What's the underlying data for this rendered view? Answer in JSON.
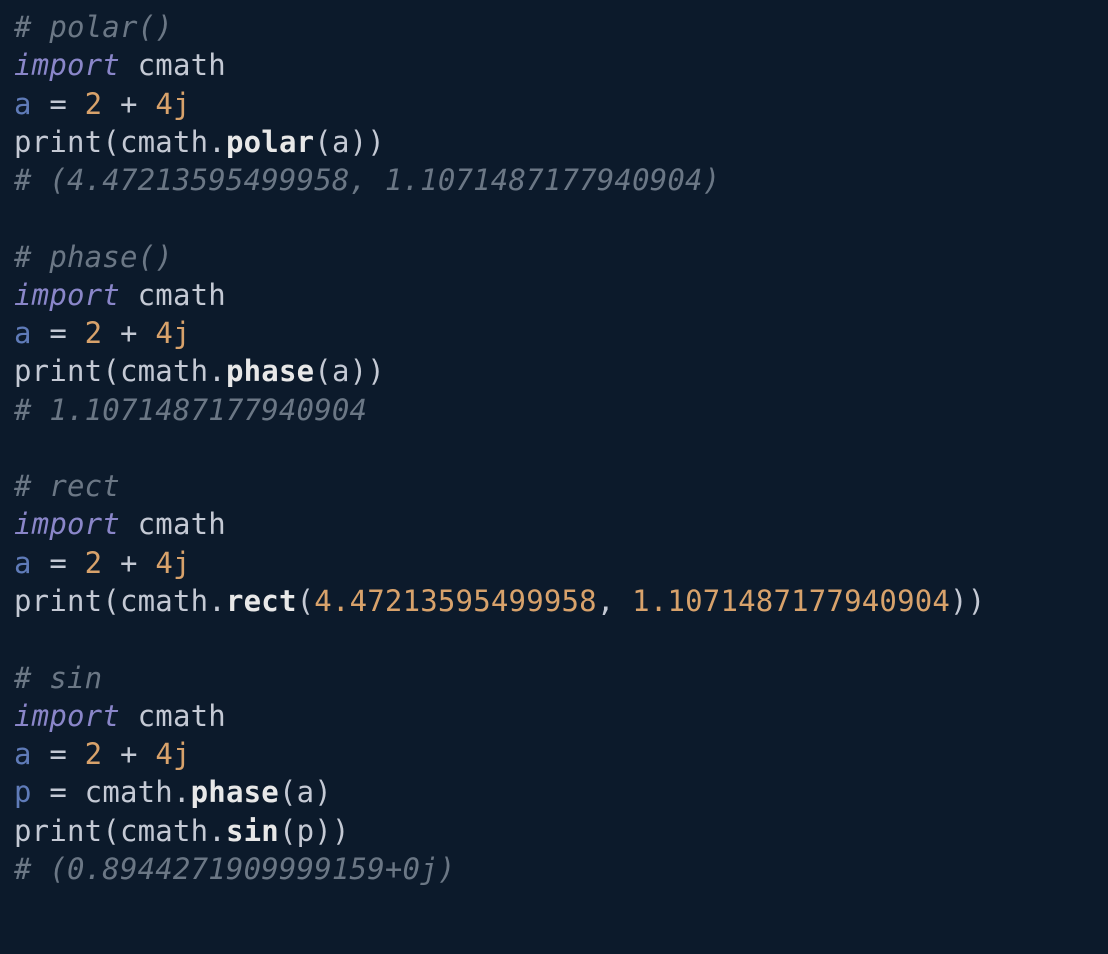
{
  "blocks": {
    "b1": {
      "comment_header": "# polar()",
      "import_kw": "import",
      "import_mod": "cmath",
      "assign_name": "a",
      "assign_eq": " = ",
      "n2": "2",
      "plus": " + ",
      "n4j": "4j",
      "print": "print",
      "lp": "(",
      "obj": "cmath",
      "dot": ".",
      "method": "polar",
      "lp2": "(",
      "arg": "a",
      "rp2": ")",
      "rp": ")",
      "comment_output": "# (4.47213595499958, 1.1071487177940904)"
    },
    "b2": {
      "comment_header": "# phase()",
      "import_kw": "import",
      "import_mod": "cmath",
      "assign_name": "a",
      "assign_eq": " = ",
      "n2": "2",
      "plus": " + ",
      "n4j": "4j",
      "print": "print",
      "lp": "(",
      "obj": "cmath",
      "dot": ".",
      "method": "phase",
      "lp2": "(",
      "arg": "a",
      "rp2": ")",
      "rp": ")",
      "comment_output": "# 1.1071487177940904"
    },
    "b3": {
      "comment_header": "# rect",
      "import_kw": "import",
      "import_mod": "cmath",
      "assign_name": "a",
      "assign_eq": " = ",
      "n2": "2",
      "plus": " + ",
      "n4j": "4j",
      "print": "print",
      "lp": "(",
      "obj": "cmath",
      "dot": ".",
      "method": "rect",
      "lp2": "(",
      "arg1": "4.47213595499958",
      "comma": ", ",
      "arg2": "1.1071487177940904",
      "rp2": ")",
      "rp": ")"
    },
    "b4": {
      "comment_header": "# sin",
      "import_kw": "import",
      "import_mod": "cmath",
      "assign_name": "a",
      "assign_eq": " = ",
      "n2": "2",
      "plus": " + ",
      "n4j": "4j",
      "p_name": "p",
      "p_eq": " = ",
      "p_obj": "cmath",
      "p_dot": ".",
      "p_method": "phase",
      "p_lp": "(",
      "p_arg": "a",
      "p_rp": ")",
      "print": "print",
      "lp": "(",
      "obj": "cmath",
      "dot": ".",
      "method": "sin",
      "lp2": "(",
      "arg": "p",
      "rp2": ")",
      "rp": ")",
      "comment_output": "# (0.8944271909999159+0j)"
    }
  }
}
